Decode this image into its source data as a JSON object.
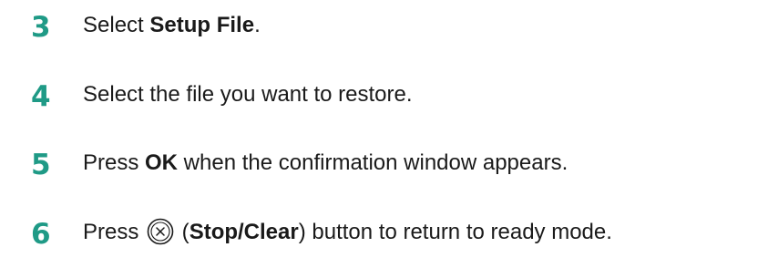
{
  "steps": [
    {
      "number": "3",
      "prefix": "Select ",
      "bold": "Setup File",
      "suffix": "."
    },
    {
      "number": "4",
      "text": "Select the file you want to restore."
    },
    {
      "number": "5",
      "prefix": "Press ",
      "bold": "OK",
      "suffix": " when the confirmation window appears."
    },
    {
      "number": "6",
      "prefix": "Press ",
      "icon": "stop-clear-button-icon",
      "open_paren": " (",
      "bold": "Stop/Clear",
      "suffix": ") button to return to ready mode."
    }
  ],
  "colors": {
    "step_number": "#1f9a86",
    "text": "#1a1a1a"
  }
}
